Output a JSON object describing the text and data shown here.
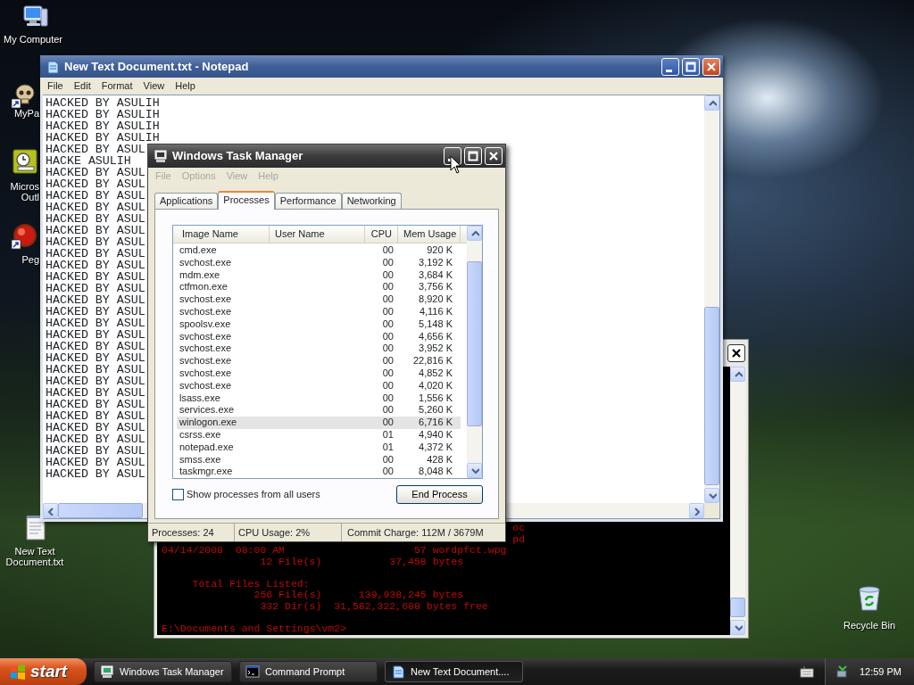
{
  "desktop_icons": [
    {
      "label": "My Computer",
      "kind": "computer",
      "shortcut": false
    },
    {
      "label": "MyPa",
      "kind": "skull",
      "shortcut": true
    },
    {
      "label": "Micros Outl",
      "kind": "clock",
      "shortcut": false
    },
    {
      "label": "Peg",
      "kind": "ball",
      "shortcut": true
    },
    {
      "label": "New Text Document.txt",
      "kind": "textfile",
      "shortcut": false
    },
    {
      "label": "Recycle Bin",
      "kind": "recycle",
      "shortcut": false
    }
  ],
  "console_window": {
    "lines": [
      {
        "kind": "fragment",
        "text": "oc"
      },
      {
        "kind": "fragment",
        "text": "pd"
      },
      {
        "kind": "file",
        "date": "04/14/2008",
        "time": "08:00 AM",
        "size": "57",
        "name": "wordpfct.wpg"
      },
      {
        "kind": "filecount",
        "count": "12 File(s)",
        "bytes": "37,458 bytes"
      },
      {
        "kind": "blank"
      },
      {
        "kind": "heading",
        "text": "Total Files Listed:"
      },
      {
        "kind": "filecount",
        "count": "256 File(s)",
        "bytes": "139,938,245 bytes"
      },
      {
        "kind": "dircount",
        "count": "332 Dir(s)",
        "bytes": "31,582,322,688 bytes free"
      },
      {
        "kind": "blank"
      },
      {
        "kind": "prompt",
        "text": "E:\\Documents and Settings\\vm2>"
      }
    ]
  },
  "notepad": {
    "title": "New Text Document.txt - Notepad",
    "menu": [
      "File",
      "Edit",
      "Format",
      "View",
      "Help"
    ],
    "lines": [
      "HACKED BY ASULIH",
      "HACKED BY ASULIH",
      "HACKED BY ASULIH",
      "HACKED BY ASULIH",
      "HACKED BY ASUL",
      "HACKE ASULIH",
      "HACKED BY ASUL",
      "HACKED BY ASUL",
      "HACKED BY ASUL",
      "HACKED BY ASUL",
      "HACKED BY ASUL",
      "HACKED BY ASUL",
      "HACKED BY ASUL",
      "HACKED BY ASUL",
      "HACKED BY ASUL",
      "HACKED BY ASUL",
      "HACKED BY ASUL",
      "HACKED BY ASUL",
      "HACKED BY ASUL",
      "HACKED BY ASUL",
      "HACKED BY ASUL",
      "HACKED BY ASUL",
      "HACKED BY ASUL",
      "HACKED BY ASUL",
      "HACKED BY ASUL",
      "HACKED BY ASUL",
      "HACKED BY ASUL",
      "HACKED BY ASUL",
      "HACKED BY ASUL",
      "HACKED BY ASUL",
      "HACKED BY ASUL",
      "HACKED BY ASUL",
      "HACKED BY ASUL"
    ]
  },
  "task_manager": {
    "title": "Windows Task Manager",
    "menu": [
      {
        "label": "File",
        "disabled": true
      },
      {
        "label": "Options",
        "disabled": true
      },
      {
        "label": "View",
        "disabled": true
      },
      {
        "label": "Help",
        "disabled": true
      }
    ],
    "tabs": [
      {
        "label": "Applications",
        "selected": false
      },
      {
        "label": "Processes",
        "selected": true
      },
      {
        "label": "Performance",
        "selected": false
      },
      {
        "label": "Networking",
        "selected": false
      }
    ],
    "columns": [
      "Image Name",
      "User Name",
      "CPU",
      "Mem Usage"
    ],
    "rows": [
      {
        "image": "cmd.exe",
        "cpu": "00",
        "mem": "920 K",
        "selected": false
      },
      {
        "image": "svchost.exe",
        "cpu": "00",
        "mem": "3,192 K",
        "selected": false
      },
      {
        "image": "mdm.exe",
        "cpu": "00",
        "mem": "3,684 K",
        "selected": false
      },
      {
        "image": "ctfmon.exe",
        "cpu": "00",
        "mem": "3,756 K",
        "selected": false
      },
      {
        "image": "svchost.exe",
        "cpu": "00",
        "mem": "8,920 K",
        "selected": false
      },
      {
        "image": "svchost.exe",
        "cpu": "00",
        "mem": "4,116 K",
        "selected": false
      },
      {
        "image": "spoolsv.exe",
        "cpu": "00",
        "mem": "5,148 K",
        "selected": false
      },
      {
        "image": "svchost.exe",
        "cpu": "00",
        "mem": "4,656 K",
        "selected": false
      },
      {
        "image": "svchost.exe",
        "cpu": "00",
        "mem": "3,952 K",
        "selected": false
      },
      {
        "image": "svchost.exe",
        "cpu": "00",
        "mem": "22,816 K",
        "selected": false
      },
      {
        "image": "svchost.exe",
        "cpu": "00",
        "mem": "4,852 K",
        "selected": false
      },
      {
        "image": "svchost.exe",
        "cpu": "00",
        "mem": "4,020 K",
        "selected": false
      },
      {
        "image": "lsass.exe",
        "cpu": "00",
        "mem": "1,556 K",
        "selected": false
      },
      {
        "image": "services.exe",
        "cpu": "00",
        "mem": "5,260 K",
        "selected": false
      },
      {
        "image": "winlogon.exe",
        "cpu": "00",
        "mem": "6,716 K",
        "selected": true
      },
      {
        "image": "csrss.exe",
        "cpu": "01",
        "mem": "4,940 K",
        "selected": false
      },
      {
        "image": "notepad.exe",
        "cpu": "01",
        "mem": "4,372 K",
        "selected": false
      },
      {
        "image": "smss.exe",
        "cpu": "00",
        "mem": "428 K",
        "selected": false
      },
      {
        "image": "taskmgr.exe",
        "cpu": "00",
        "mem": "8,048 K",
        "selected": false
      }
    ],
    "show_all_users": {
      "label": "Show processes from all users",
      "checked": false
    },
    "end_button": "End Process",
    "status": [
      "Processes: 24",
      "CPU Usage: 2%",
      "Commit Charge: 112M / 3679M"
    ]
  },
  "taskbar": {
    "start": "start",
    "items": [
      {
        "label": "Windows Task Manager",
        "kind": "taskmgr",
        "selected": false
      },
      {
        "label": "Command Prompt",
        "kind": "cmd",
        "selected": false
      },
      {
        "label": "New Text Document....",
        "kind": "notepad",
        "selected": true
      }
    ],
    "clock": "12:59 PM"
  }
}
